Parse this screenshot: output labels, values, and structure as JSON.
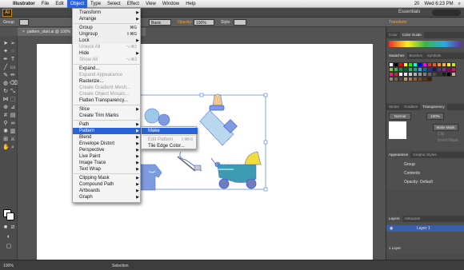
{
  "menubar": {
    "app": "Illustrator",
    "items": [
      "File",
      "Edit",
      "Object",
      "Type",
      "Select",
      "Effect",
      "View",
      "Window",
      "Help"
    ],
    "active": "Object",
    "clock": "Wed 6:23 PM",
    "battery": "20"
  },
  "appbar": {
    "logo": "Ai",
    "workspace": "Essentials"
  },
  "controlbar": {
    "selection": "Group",
    "stroke_style": "Basic",
    "opacity_label": "Opacity:",
    "opacity_value": "100%",
    "style_label": "Style:",
    "transform_label": "Transform"
  },
  "document_tab": {
    "title": "pattern_start.ai @ 100%"
  },
  "object_menu": {
    "items": [
      {
        "label": "Transform",
        "arrow": true
      },
      {
        "label": "Arrange",
        "arrow": true
      },
      {
        "sep": true
      },
      {
        "label": "Group",
        "shortcut": "⌘G"
      },
      {
        "label": "Ungroup",
        "shortcut": "⇧⌘G"
      },
      {
        "label": "Lock",
        "arrow": true
      },
      {
        "label": "Unlock All",
        "shortcut": "⌥⌘2",
        "disabled": true
      },
      {
        "label": "Hide",
        "arrow": true
      },
      {
        "label": "Show All",
        "shortcut": "⌥⌘3",
        "disabled": true
      },
      {
        "sep": true
      },
      {
        "label": "Expand..."
      },
      {
        "label": "Expand Appearance",
        "disabled": true
      },
      {
        "label": "Rasterize..."
      },
      {
        "label": "Create Gradient Mesh...",
        "disabled": true
      },
      {
        "label": "Create Object Mosaic...",
        "disabled": true
      },
      {
        "label": "Flatten Transparency..."
      },
      {
        "sep": true
      },
      {
        "label": "Slice",
        "arrow": true
      },
      {
        "label": "Create Trim Marks"
      },
      {
        "sep": true
      },
      {
        "label": "Path",
        "arrow": true
      },
      {
        "label": "Pattern",
        "arrow": true,
        "highlight": true
      },
      {
        "label": "Blend",
        "arrow": true
      },
      {
        "label": "Envelope Distort",
        "arrow": true
      },
      {
        "label": "Perspective",
        "arrow": true
      },
      {
        "label": "Live Paint",
        "arrow": true
      },
      {
        "label": "Image Trace",
        "arrow": true
      },
      {
        "label": "Text Wrap",
        "arrow": true
      },
      {
        "sep": true
      },
      {
        "label": "Clipping Mask",
        "arrow": true
      },
      {
        "label": "Compound Path",
        "arrow": true
      },
      {
        "label": "Artboards",
        "arrow": true
      },
      {
        "label": "Graph",
        "arrow": true
      }
    ]
  },
  "pattern_submenu": {
    "items": [
      {
        "label": "Make",
        "highlight": true
      },
      {
        "sep": true
      },
      {
        "label": "Edit Pattern",
        "shortcut": "⇧⌘F8",
        "disabled": true
      },
      {
        "label": "Tile Edge Color..."
      }
    ]
  },
  "panels": {
    "color_tabs": [
      "Color",
      "Color Guide"
    ],
    "swatch_tabs": [
      "Swatches",
      "Brushes",
      "Symbols"
    ],
    "swatch_colors": [
      "#ffffff",
      "#000000",
      "#ff0000",
      "#ffff00",
      "#00ff00",
      "#00ffff",
      "#0000ff",
      "#ff00ff",
      "#e8302c",
      "#f05a28",
      "#f7931e",
      "#fbb03b",
      "#fcee21",
      "#d9e021",
      "#8cc63f",
      "#39b54a",
      "#009245",
      "#006837",
      "#22b573",
      "#00a99d",
      "#29abe2",
      "#0071bc",
      "#2e3192",
      "#1b1464",
      "#662d91",
      "#93278f",
      "#9e005d",
      "#d4145a",
      "#ed1e79",
      "#c1272d",
      "#ffffff",
      "#e6e6e6",
      "#cccccc",
      "#b3b3b3",
      "#999999",
      "#808080",
      "#666666",
      "#4d4d4d",
      "#333333",
      "#1a1a1a",
      "#000000",
      "#c7b299",
      "#998675",
      "#736357",
      "#534741",
      "#c69c6d",
      "#a67c52",
      "#8c6239",
      "#754c24",
      "#603813",
      "#42210b"
    ],
    "transparency_tabs": [
      "Stroke",
      "Gradient",
      "Transparency"
    ],
    "blend_mode": "Normal",
    "opacity_value": "100%",
    "make_mask_label": "Make Mask",
    "clip_label": "Clip",
    "invert_label": "Invert Mask",
    "appearance_tabs": [
      "Appearance",
      "Graphic Styles"
    ],
    "appearance_group": "Group",
    "appearance_contents": "Contents",
    "appearance_opacity": "Opacity:",
    "appearance_opacity_value": "Default",
    "layers_tabs": [
      "Layers",
      "Artboards"
    ],
    "layer_name": "Layer 1",
    "layers_count": "1 Layer"
  },
  "statusbar": {
    "zoom": "100%",
    "tool": "Selection"
  }
}
